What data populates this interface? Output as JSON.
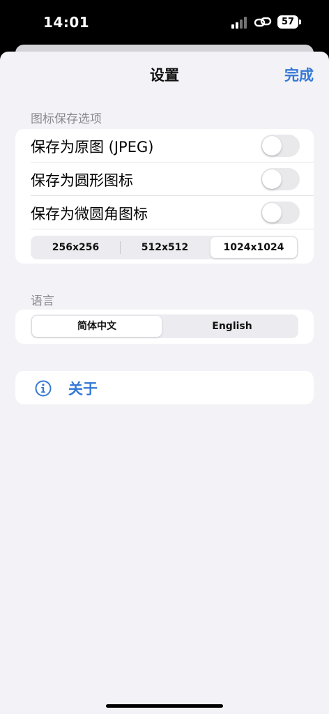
{
  "status_bar": {
    "time": "14:01",
    "battery": "57"
  },
  "nav": {
    "title": "设置",
    "done_label": "完成"
  },
  "icon_save_section": {
    "header": "图标保存选项",
    "options": [
      {
        "label": "保存为原图 (JPEG)",
        "enabled": false
      },
      {
        "label": "保存为圆形图标",
        "enabled": false
      },
      {
        "label": "保存为微圆角图标",
        "enabled": false
      }
    ],
    "sizes": [
      "256x256",
      "512x512",
      "1024x1024"
    ],
    "selected_size": "1024x1024"
  },
  "language_section": {
    "header": "语言",
    "options": [
      "简体中文",
      "English"
    ],
    "selected": "简体中文"
  },
  "about": {
    "label": "关于",
    "icon": "info-icon"
  },
  "colors": {
    "accent": "#3478d6",
    "background": "#f2f2f7",
    "card": "#ffffff",
    "section_header": "#8a8a8e"
  }
}
